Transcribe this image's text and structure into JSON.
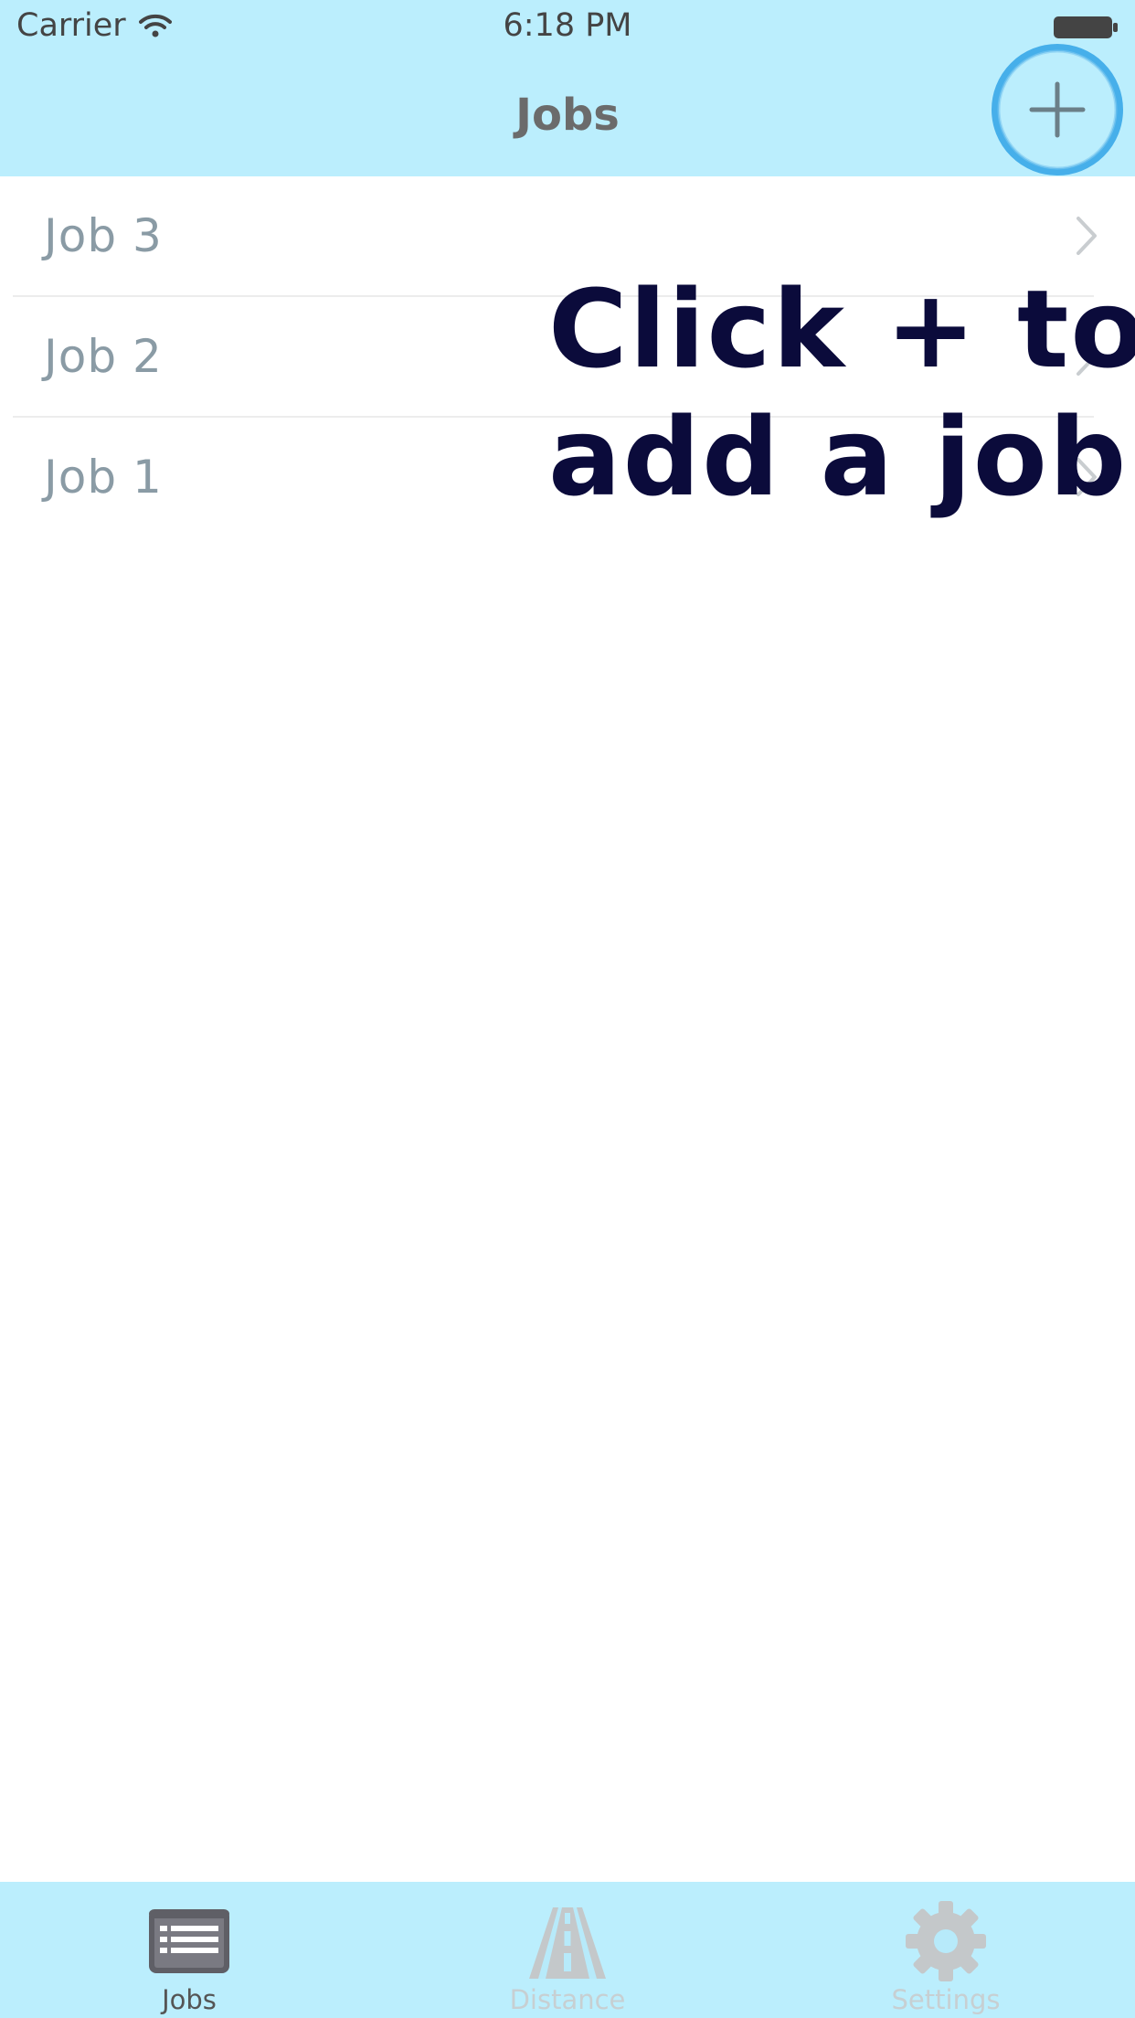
{
  "status_bar": {
    "carrier": "Carrier",
    "time": "6:18 PM"
  },
  "nav": {
    "title": "Jobs",
    "add_icon": "plus-icon"
  },
  "jobs": [
    {
      "label": "Job 3"
    },
    {
      "label": "Job 2"
    },
    {
      "label": "Job 1"
    }
  ],
  "hint": {
    "line1": "Click + to",
    "line2": "add a job"
  },
  "tabs": [
    {
      "label": "Jobs",
      "icon": "list-icon",
      "active": true
    },
    {
      "label": "Distance",
      "icon": "road-icon",
      "active": false
    },
    {
      "label": "Settings",
      "icon": "gear-icon",
      "active": false
    }
  ],
  "colors": {
    "bar_background": "#bbeefd",
    "highlight_ring": "#3aa7e8",
    "hint_text": "#0b0b3b",
    "job_text": "#8a9ba5"
  }
}
